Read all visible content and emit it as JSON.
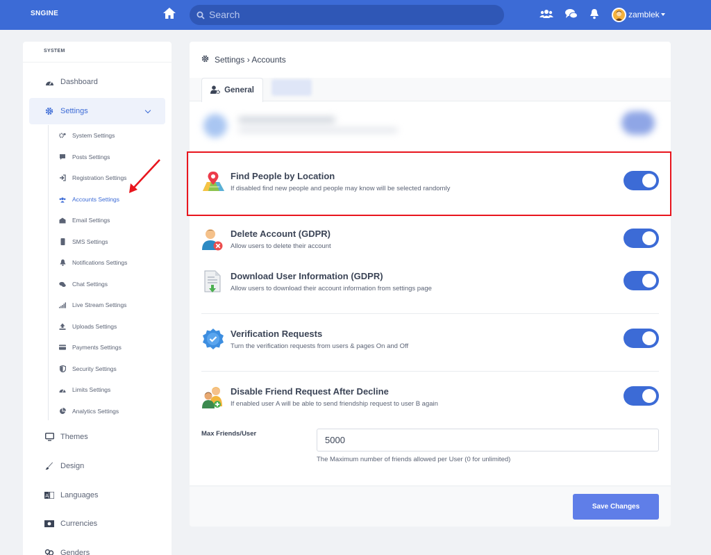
{
  "topbar": {
    "brand": "SNGINE",
    "search_placeholder": "Search",
    "username": "zamblek",
    "icons": [
      "home-icon",
      "search-icon",
      "users-icon",
      "chat-icon",
      "bell-icon"
    ],
    "accent": "#3c6bd6"
  },
  "sidebar": {
    "section_title": "SYSTEM",
    "items": [
      {
        "label": "Dashboard",
        "icon": "dashboard-icon"
      },
      {
        "label": "Settings",
        "icon": "gear-icon",
        "active": true
      },
      {
        "label": "Themes",
        "icon": "monitor-icon"
      },
      {
        "label": "Design",
        "icon": "brush-icon"
      },
      {
        "label": "Languages",
        "icon": "language-icon"
      },
      {
        "label": "Currencies",
        "icon": "money-icon"
      },
      {
        "label": "Genders",
        "icon": "genders-icon"
      }
    ],
    "submenu": [
      {
        "label": "System Settings",
        "icon": "cogs-icon"
      },
      {
        "label": "Posts Settings",
        "icon": "comment-icon"
      },
      {
        "label": "Registration Settings",
        "icon": "sign-in-icon"
      },
      {
        "label": "Accounts Settings",
        "icon": "users-icon",
        "active": true
      },
      {
        "label": "Email Settings",
        "icon": "envelope-icon"
      },
      {
        "label": "SMS Settings",
        "icon": "mobile-icon"
      },
      {
        "label": "Notifications Settings",
        "icon": "bell-icon"
      },
      {
        "label": "Chat Settings",
        "icon": "chat-icon"
      },
      {
        "label": "Live Stream Settings",
        "icon": "signal-icon"
      },
      {
        "label": "Uploads Settings",
        "icon": "upload-icon"
      },
      {
        "label": "Payments Settings",
        "icon": "credit-card-icon"
      },
      {
        "label": "Security Settings",
        "icon": "shield-icon"
      },
      {
        "label": "Limits Settings",
        "icon": "gauge-icon"
      },
      {
        "label": "Analytics Settings",
        "icon": "pie-chart-icon"
      }
    ]
  },
  "main": {
    "breadcrumb": "Settings › Accounts",
    "tabs": [
      {
        "label": "General",
        "icon": "user-cog-icon",
        "active": true
      }
    ],
    "settings": [
      {
        "title": "Find People by Location",
        "description": "If disabled find new people and people may know will be selected randomly",
        "enabled": true,
        "icon": "map-pin-icon"
      },
      {
        "title": "Delete Account (GDPR)",
        "description": "Allow users to delete their account",
        "enabled": true,
        "icon": "user-delete-icon"
      },
      {
        "title": "Download User Information (GDPR)",
        "description": "Allow users to download their account information from settings page",
        "enabled": true,
        "icon": "document-download-icon"
      },
      {
        "title": "Verification Requests",
        "description": "Turn the verification requests from users & pages On and Off",
        "enabled": true,
        "icon": "verified-badge-icon"
      },
      {
        "title": "Disable Friend Request After Decline",
        "description": "If enabled user A will be able to send friendship request to user B again",
        "enabled": true,
        "icon": "friends-icon"
      }
    ],
    "max_friends": {
      "label": "Max Friends/User",
      "value": "5000",
      "help": "The Maximum number of friends allowed per User (0 for unlimited)"
    },
    "save_label": "Save Changes"
  },
  "colors": {
    "highlight_border": "#e8151d",
    "toggle_on": "#3c6bd6",
    "save_button": "#5f7ee8"
  }
}
